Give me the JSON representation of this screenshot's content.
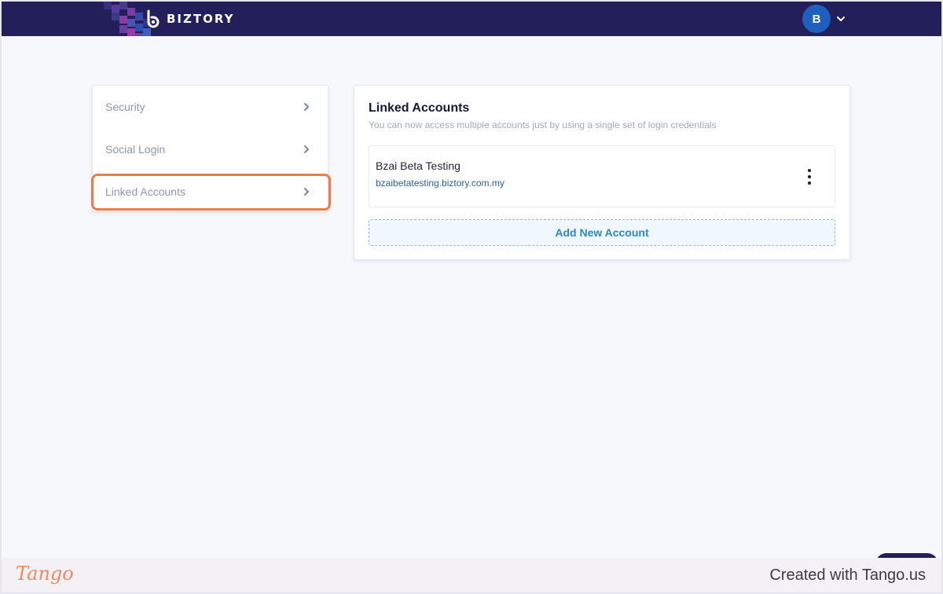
{
  "header": {
    "brand": "BIZTORY",
    "avatar_initial": "B",
    "colors": {
      "bar": "#221f5a",
      "avatar": "#1f5fbf"
    }
  },
  "menu": {
    "items": [
      {
        "label": "Security"
      },
      {
        "label": "Social Login"
      },
      {
        "label": "Linked Accounts"
      }
    ],
    "highlight_color": "#f07a45"
  },
  "linked_accounts": {
    "title": "Linked Accounts",
    "subtitle": "You can now access multiple accounts just by using a single set of login credentials",
    "accounts": [
      {
        "name": "Bzai Beta Testing",
        "url": "bzaibetatesting.biztory.com.my"
      }
    ],
    "add_button_label": "Add New Account"
  },
  "footer": {
    "logo_text": "Tango",
    "created_text": "Created with Tango.us"
  }
}
